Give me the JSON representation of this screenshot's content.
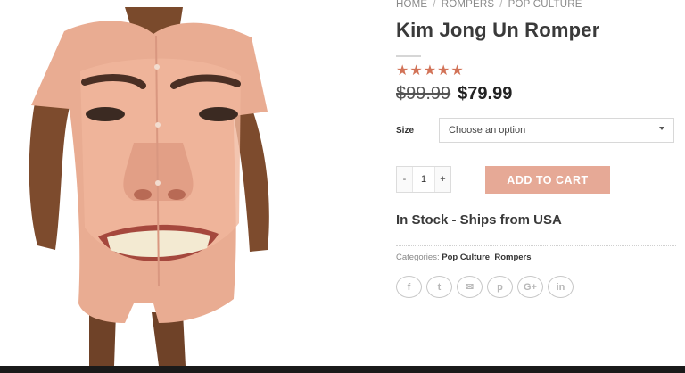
{
  "breadcrumb": {
    "home": "HOME",
    "separator": "/",
    "rompers": "ROMPERS",
    "pop_culture": "POP CULTURE"
  },
  "product": {
    "title": "Kim Jong Un Romper",
    "rating_stars": 5,
    "price_old": "$99.99",
    "price_new": "$79.99",
    "size_label": "Size",
    "size_placeholder": "Choose an option",
    "quantity": "1",
    "qty_minus": "-",
    "qty_plus": "+",
    "add_to_cart": "ADD TO CART",
    "stock": "In Stock - Ships from USA"
  },
  "categories": {
    "label": "Categories:",
    "items": [
      "Pop Culture",
      "Rompers"
    ],
    "separator": ","
  },
  "share_icons": [
    "facebook-icon",
    "twitter-icon",
    "email-icon",
    "pinterest-icon",
    "google-plus-icon",
    "linkedin-icon"
  ],
  "share_glyphs": [
    "f",
    "t",
    "✉",
    "p",
    "G+",
    "in"
  ],
  "colors": {
    "accent": "#d27358",
    "button": "#e6a996",
    "text": "#3a3a3a"
  }
}
